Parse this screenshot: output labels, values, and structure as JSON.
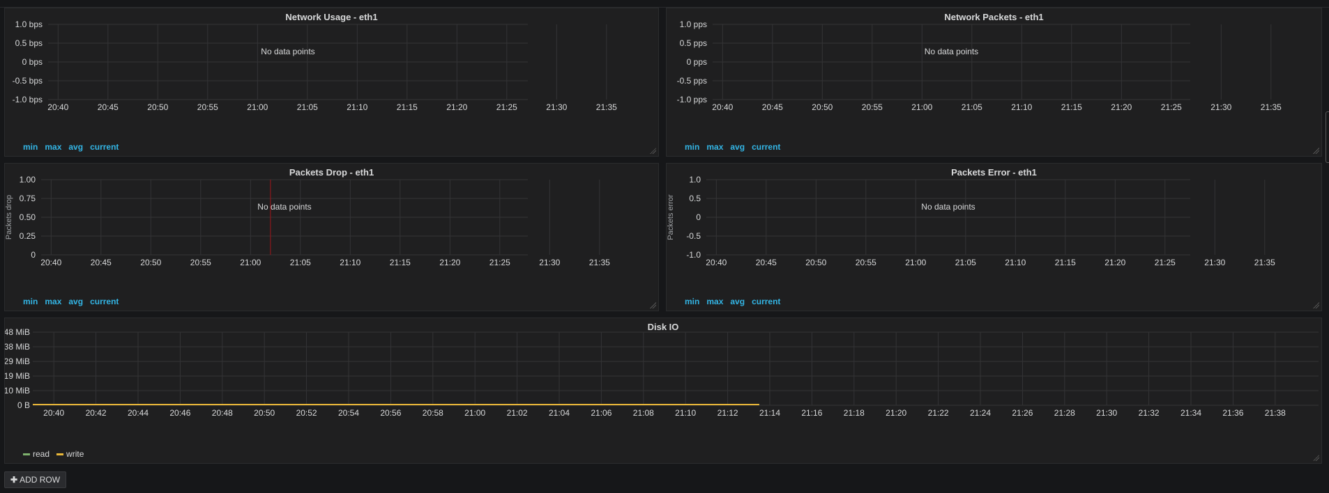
{
  "panels": [
    {
      "id": "p1",
      "title": "Network Usage - eth1",
      "no_data": "No data points",
      "ylabel": "",
      "y_ticks": [
        "1.0 bps",
        "0.5 bps",
        "0 bps",
        "-0.5 bps",
        "-1.0 bps"
      ],
      "x_ticks": [
        "20:40",
        "20:45",
        "20:50",
        "20:55",
        "21:00",
        "21:05",
        "21:10",
        "21:15",
        "21:20",
        "21:25",
        "21:30",
        "21:35"
      ],
      "legend": [
        "min",
        "max",
        "avg",
        "current"
      ]
    },
    {
      "id": "p2",
      "title": "Network Packets - eth1",
      "no_data": "No data points",
      "ylabel": "",
      "y_ticks": [
        "1.0 pps",
        "0.5 pps",
        "0 pps",
        "-0.5 pps",
        "-1.0 pps"
      ],
      "x_ticks": [
        "20:40",
        "20:45",
        "20:50",
        "20:55",
        "21:00",
        "21:05",
        "21:10",
        "21:15",
        "21:20",
        "21:25",
        "21:30",
        "21:35"
      ],
      "legend": [
        "min",
        "max",
        "avg",
        "current"
      ]
    },
    {
      "id": "p3",
      "title": "Packets Drop - eth1",
      "no_data": "No data points",
      "ylabel": "Packets drop",
      "y_ticks": [
        "1.00",
        "0.75",
        "0.50",
        "0.25",
        "0"
      ],
      "x_ticks": [
        "20:40",
        "20:45",
        "20:50",
        "20:55",
        "21:00",
        "21:05",
        "21:10",
        "21:15",
        "21:20",
        "21:25",
        "21:30",
        "21:35"
      ],
      "legend": [
        "min",
        "max",
        "avg",
        "current"
      ],
      "marker_time": "21:02"
    },
    {
      "id": "p4",
      "title": "Packets Error - eth1",
      "no_data": "No data points",
      "ylabel": "Packets error",
      "y_ticks": [
        "1.0",
        "0.5",
        "0",
        "-0.5",
        "-1.0"
      ],
      "x_ticks": [
        "20:40",
        "20:45",
        "20:50",
        "20:55",
        "21:00",
        "21:05",
        "21:10",
        "21:15",
        "21:20",
        "21:25",
        "21:30",
        "21:35"
      ],
      "legend": [
        "min",
        "max",
        "avg",
        "current"
      ]
    }
  ],
  "disk_io": {
    "title": "Disk IO",
    "legend": [
      {
        "name": "read",
        "color": "#7eb26d"
      },
      {
        "name": "write",
        "color": "#eab839"
      }
    ]
  },
  "chart_data": {
    "type": "line",
    "title": "Disk IO",
    "x": [
      "20:40",
      "20:42",
      "20:44",
      "20:46",
      "20:48",
      "20:50",
      "20:52",
      "20:54",
      "20:56",
      "20:58",
      "21:00",
      "21:02",
      "21:04",
      "21:06",
      "21:08",
      "21:10",
      "21:12",
      "21:14",
      "21:16",
      "21:18",
      "21:20",
      "21:22",
      "21:24",
      "21:26",
      "21:28",
      "21:30",
      "21:32",
      "21:34",
      "21:36",
      "21:38"
    ],
    "y_ticks": [
      "48 MiB",
      "38 MiB",
      "29 MiB",
      "19 MiB",
      "10 MiB",
      "0 B"
    ],
    "ylim": [
      0,
      48
    ],
    "series": [
      {
        "name": "read",
        "color": "#7eb26d",
        "x_range": [
          "20:39",
          "21:13.5"
        ],
        "value": 0
      },
      {
        "name": "write",
        "color": "#eab839",
        "x_range": [
          "20:39",
          "21:13.5"
        ],
        "value": 0
      }
    ]
  },
  "add_row": {
    "icon": "plus-icon",
    "label": "ADD ROW"
  }
}
